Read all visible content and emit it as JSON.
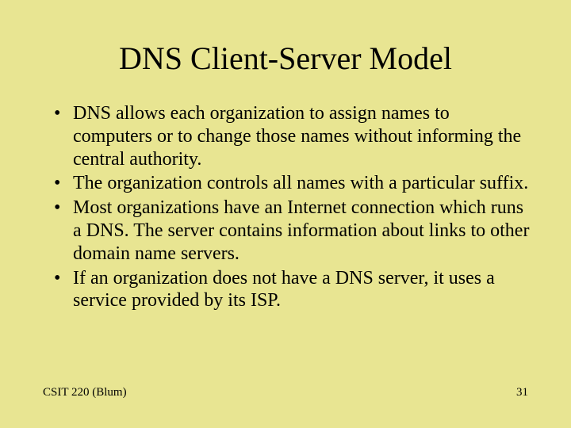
{
  "slide": {
    "title": "DNS Client-Server Model",
    "bullets": [
      "DNS allows each organization to assign names to computers or to change those names without informing the central authority.",
      "The organization controls all names with a particular suffix.",
      "Most organizations have an Internet connection which runs a DNS.  The server contains information about links to other domain name servers.",
      "If an organization does not have a DNS server, it uses a service provided by its ISP."
    ],
    "footer": {
      "left": "CSIT 220 (Blum)",
      "right": "31"
    }
  }
}
